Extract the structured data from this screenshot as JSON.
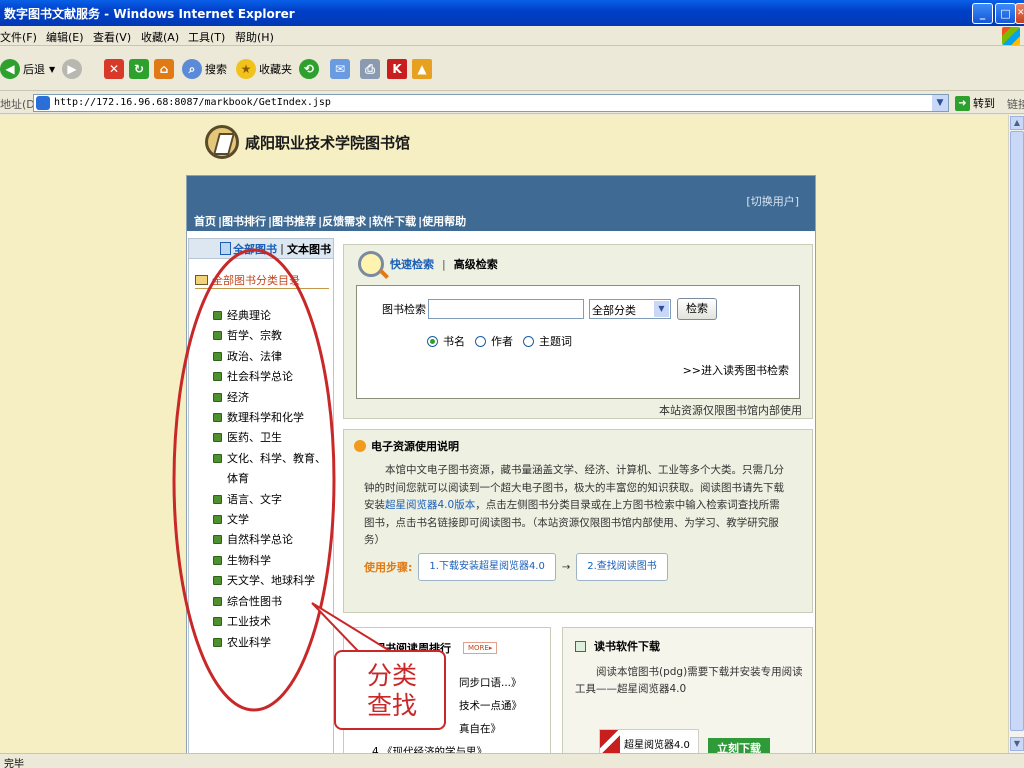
{
  "window": {
    "title": "数字图书文献服务 - Windows Internet Explorer",
    "minimize_glyph": "_",
    "maximize_glyph": "□",
    "close_glyph": "✕"
  },
  "menu": [
    "文件(F)",
    "编辑(E)",
    "查看(V)",
    "收藏(A)",
    "工具(T)",
    "帮助(H)"
  ],
  "toolbar": {
    "back_label": "后退",
    "back_glyph": "◀",
    "forward_glyph": "▶",
    "stop_glyph": "✕",
    "refresh_glyph": "↻",
    "home_glyph": "⌂",
    "search_label": "搜索",
    "favorites_label": "收藏夹",
    "history_glyph": "⟲",
    "mail_glyph": "✉",
    "print_glyph": "⎙"
  },
  "address": {
    "label": "地址(D)",
    "url": "http://172.16.96.68:8087/markbook/GetIndex.jsp",
    "dropdown_glyph": "▼",
    "go_label": "转到",
    "go_glyph": "➜",
    "links_label": "链接"
  },
  "status": {
    "text": "完毕"
  },
  "scroll": {
    "up_glyph": "▲",
    "down_glyph": "▼"
  },
  "site": {
    "library_name": "咸阳职业技术学院图书馆",
    "switch_user": "[切换用户]",
    "nav": [
      "首页",
      "|图书排行",
      "|图书推荐",
      "|反馈需求",
      "|软件下载",
      "|使用帮助"
    ]
  },
  "left_panel": {
    "tab_all": "全部图书",
    "tab_sep": "|",
    "tab_text": "文本图书",
    "catalog_title": "全部图书分类目录",
    "categories": [
      "经典理论",
      "哲学、宗教",
      "政治、法律",
      "社会科学总论",
      "经济",
      "数理科学和化学",
      "医药、卫生",
      "文化、科学、教育、体育",
      "语言、文字",
      "文学",
      "自然科学总论",
      "生物科学",
      "天文学、地球科学",
      "综合性图书",
      "工业技术",
      "农业科学"
    ]
  },
  "search": {
    "tab_quick": "快速检索",
    "tab_sep": "|",
    "tab_advanced": "高级检索",
    "field_label": "图书检索",
    "query_value": "",
    "category_selected": "全部分类",
    "category_dropdown_glyph": "▼",
    "search_button": "检索",
    "options": [
      {
        "label": "书名",
        "checked": true
      },
      {
        "label": "作者",
        "checked": false
      },
      {
        "label": "主题词",
        "checked": false
      }
    ],
    "advanced_link": ">>进入读秀图书检索",
    "note": "本站资源仅限图书馆内部使用"
  },
  "guide": {
    "title": "电子资源使用说明",
    "body_1": "本馆中文电子图书资源，藏书量涵盖文学、经济、计算机、工业等多个大类。只需几分钟的时间您就可以阅读到一个超大电子图书，极大的丰富您的知识获取。阅读图书请先下载安装",
    "body_link": "超星阅览器4.0版本",
    "body_2": "，点击左侧图书分类目录或在上方图书检索中输入检索词查找所需图书，点击书名链接即可阅读图书。（本站资源仅限图书馆内部使用、为学习、教学研究服务）",
    "steps_label": "使用步骤:",
    "step1": "1.下载安装超星阅览器4.0",
    "step_arrow": "→",
    "step2": "2.查找阅读图书"
  },
  "ranking": {
    "title": "图书阅读周排行",
    "more": "MORE▸",
    "items": [
      "同步口语...》",
      "技术一点通》",
      "真自在》",
      "4.《现代经济的学与思》"
    ]
  },
  "download": {
    "title": "读书软件下载",
    "body": "阅读本馆图书(pdg)需要下载并安装专用阅读工具——超星阅览器4.0",
    "reader_label": "超星阅览器4.0",
    "download_button": "立刻下载"
  },
  "annotation": {
    "callout_line1": "分类",
    "callout_line2": "查找",
    "color": "#C82828"
  }
}
